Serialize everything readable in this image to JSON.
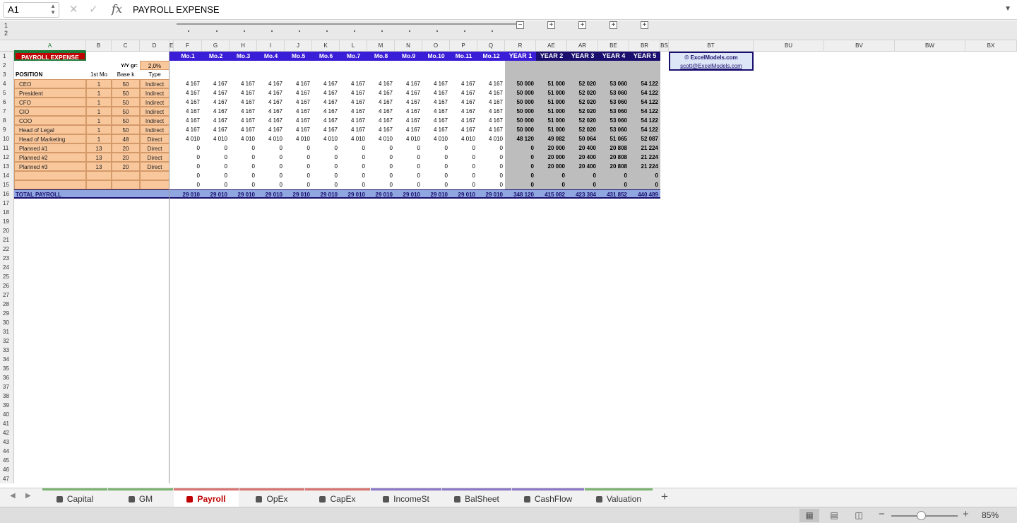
{
  "formula_bar": {
    "name_box": "A1",
    "fx": "fx",
    "value": "PAYROLL EXPENSE"
  },
  "outline_levels": [
    "1",
    "2"
  ],
  "columns": [
    "A",
    "B",
    "C",
    "D",
    "E",
    "F",
    "G",
    "H",
    "I",
    "J",
    "K",
    "L",
    "M",
    "N",
    "O",
    "P",
    "Q",
    "R",
    "AE",
    "AR",
    "BE",
    "BR",
    "BS",
    "BT",
    "BU",
    "BV",
    "BW",
    "BX"
  ],
  "rows": [
    "1",
    "2",
    "3",
    "4",
    "5",
    "6",
    "7",
    "8",
    "9",
    "10",
    "11",
    "12",
    "13",
    "14",
    "15",
    "16",
    "17",
    "18",
    "19",
    "20",
    "21",
    "22",
    "23",
    "24",
    "25",
    "26",
    "27",
    "28",
    "29",
    "30",
    "31",
    "32",
    "33",
    "34",
    "35",
    "36",
    "37",
    "38",
    "39",
    "40",
    "41",
    "42",
    "43",
    "44",
    "45",
    "46",
    "47"
  ],
  "sheet": {
    "title": "PAYROLL EXPENSE",
    "yy_label": "Y/Y gr:",
    "yy_value": "2,0%",
    "headers": [
      "POSITION",
      "1st Mo",
      "Base k",
      "Type"
    ],
    "month_headers": [
      "Mo.1",
      "Mo.2",
      "Mo.3",
      "Mo.4",
      "Mo.5",
      "Mo.6",
      "Mo.7",
      "Mo.8",
      "Mo.9",
      "Mo.10",
      "Mo.11",
      "Mo.12"
    ],
    "year_headers": [
      "YEAR 1",
      "YEAR 2",
      "YEAR 3",
      "YEAR 4",
      "YEAR 5"
    ],
    "credit": {
      "name": "© ExcelModels.com",
      "email": "scott@ExcelModels.com"
    },
    "positions": [
      {
        "name": "CEO",
        "first": "1",
        "base": "50",
        "type": "Indirect",
        "monthly": "4 167",
        "last": "4 167",
        "years": [
          "50 000",
          "51 000",
          "52 020",
          "53 060",
          "54 122"
        ]
      },
      {
        "name": "President",
        "first": "1",
        "base": "50",
        "type": "Indirect",
        "monthly": "4 167",
        "last": "4 167",
        "years": [
          "50 000",
          "51 000",
          "52 020",
          "53 060",
          "54 122"
        ]
      },
      {
        "name": "CFO",
        "first": "1",
        "base": "50",
        "type": "Indirect",
        "monthly": "4 167",
        "last": "4 167",
        "years": [
          "50 000",
          "51 000",
          "52 020",
          "53 060",
          "54 122"
        ]
      },
      {
        "name": "CIO",
        "first": "1",
        "base": "50",
        "type": "Indirect",
        "monthly": "4 167",
        "last": "4 167",
        "years": [
          "50 000",
          "51 000",
          "52 020",
          "53 060",
          "54 122"
        ]
      },
      {
        "name": "COO",
        "first": "1",
        "base": "50",
        "type": "Indirect",
        "monthly": "4 167",
        "last": "4 167",
        "years": [
          "50 000",
          "51 000",
          "52 020",
          "53 060",
          "54 122"
        ]
      },
      {
        "name": "Head of Legal",
        "first": "1",
        "base": "50",
        "type": "Indirect",
        "monthly": "4 167",
        "last": "4 167",
        "years": [
          "50 000",
          "51 000",
          "52 020",
          "53 060",
          "54 122"
        ]
      },
      {
        "name": "Head of Marketing",
        "first": "1",
        "base": "48",
        "type": "Direct",
        "monthly": "4 010",
        "last": "4 010",
        "years": [
          "48 120",
          "49 082",
          "50 064",
          "51 065",
          "52 087"
        ]
      },
      {
        "name": "Planned #1",
        "first": "13",
        "base": "20",
        "type": "Direct",
        "monthly": "0",
        "last": "0",
        "years": [
          "0",
          "20 000",
          "20 400",
          "20 808",
          "21 224"
        ]
      },
      {
        "name": "Planned #2",
        "first": "13",
        "base": "20",
        "type": "Direct",
        "monthly": "0",
        "last": "0",
        "years": [
          "0",
          "20 000",
          "20 400",
          "20 808",
          "21 224"
        ]
      },
      {
        "name": "Planned #3",
        "first": "13",
        "base": "20",
        "type": "Direct",
        "monthly": "0",
        "last": "0",
        "years": [
          "0",
          "20 000",
          "20 400",
          "20 808",
          "21 224"
        ]
      },
      {
        "name": "",
        "first": "",
        "base": "",
        "type": "",
        "monthly": "0",
        "last": "0",
        "years": [
          "0",
          "0",
          "0",
          "0",
          "0"
        ]
      },
      {
        "name": "",
        "first": "",
        "base": "",
        "type": "",
        "monthly": "0",
        "last": "0",
        "years": [
          "0",
          "0",
          "0",
          "0",
          "0"
        ]
      }
    ],
    "total": {
      "label": "TOTAL PAYROLL",
      "monthly": "29 010",
      "years": [
        "348 120",
        "415 082",
        "423 384",
        "431 852",
        "440 489"
      ]
    }
  },
  "tabs": [
    {
      "label": "Capital",
      "color": "#79b36f",
      "active": false
    },
    {
      "label": "GM",
      "color": "#79b36f",
      "active": false
    },
    {
      "label": "Payroll",
      "color": "#d97370",
      "active": true
    },
    {
      "label": "OpEx",
      "color": "#d97370",
      "active": false
    },
    {
      "label": "CapEx",
      "color": "#d97370",
      "active": false
    },
    {
      "label": "IncomeSt",
      "color": "#8b77c6",
      "active": false
    },
    {
      "label": "BalSheet",
      "color": "#8b77c6",
      "active": false
    },
    {
      "label": "CashFlow",
      "color": "#8b77c6",
      "active": false
    },
    {
      "label": "Valuation",
      "color": "#79b36f",
      "active": false
    }
  ],
  "add_sheet": "+",
  "zoom": {
    "label": "85%",
    "level": 0.45,
    "minus": "−",
    "plus": "+"
  }
}
